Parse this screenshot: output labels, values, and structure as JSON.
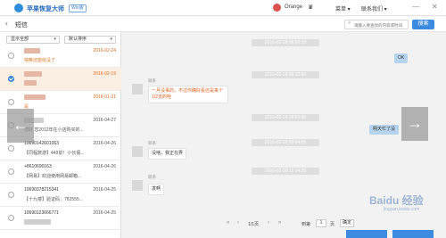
{
  "app": {
    "title": "苹果恢复大师",
    "badge": "Win版"
  },
  "user": {
    "name": "Orange"
  },
  "topmenu": {
    "menu": "菜单",
    "contact": "联系我们",
    "minimize": "—",
    "close": "✕"
  },
  "subheader": {
    "back": "‹",
    "title": "短信",
    "search_placeholder": "请输入要查找的内容或时间",
    "search_button": "搜索"
  },
  "filters": {
    "show_all": "显示全部",
    "default_sort": "默认排序"
  },
  "list": [
    {
      "name": "",
      "date": "2016-02-24",
      "preview": "啥嘛还能收没了",
      "selected": false,
      "checked": false,
      "orange": true
    },
    {
      "name": "",
      "date": "2016-02-19",
      "preview": "",
      "selected": true,
      "checked": true,
      "orange": true
    },
    {
      "name": "",
      "date": "2016-01-21",
      "preview": "是",
      "selected": false,
      "checked": false,
      "orange": true
    },
    {
      "name": "",
      "date": "2016-04-27",
      "preview": "您好 您2012年在小店购买的...",
      "selected": false,
      "checked": false,
      "orange": false
    },
    {
      "name": "10690142601063",
      "date": "2016-04-26",
      "preview": "【同程旅游】449前！小长假...",
      "selected": false,
      "checked": false,
      "orange": false
    },
    {
      "name": "+8610690163",
      "date": "2016-04-26",
      "preview": "【网易】欢迎使用网易邮箱...",
      "selected": false,
      "checked": false,
      "orange": false
    },
    {
      "name": "10690378215341",
      "date": "2016-04-25",
      "preview": "【十九楼】验证码：782555...",
      "selected": false,
      "checked": false,
      "orange": false
    },
    {
      "name": "10690123666771",
      "date": "2016-04-25",
      "preview": "",
      "selected": false,
      "checked": false,
      "orange": false
    }
  ],
  "chat": {
    "times": [
      "2016-02-18 06:56:10",
      "2016-02-18 08:32:50",
      "2016-02-18 09:01:05",
      "2016-02-18 09:04:05",
      "2016-02-18 11:14:25"
    ],
    "messages": {
      "out_ok": "OK",
      "in_1": "一月没事的，不过你确好看还是来个1/2天的哈",
      "out_2": "明天忙了没",
      "in_3": "没啥，我正在弄",
      "in_4": "发啊",
      "sender": "联系"
    }
  },
  "pager": {
    "first": "«",
    "prev": "‹",
    "page_info": "1/1页",
    "next": "›",
    "last": "»",
    "goto_label": "到第",
    "page_value": "1",
    "page_unit": "页",
    "go": "确定"
  },
  "nav": {
    "left_arrow": "←",
    "right_arrow": "→"
  },
  "watermark": {
    "brand": "Baidu 经验",
    "url": "jingyan.baidu.com"
  }
}
